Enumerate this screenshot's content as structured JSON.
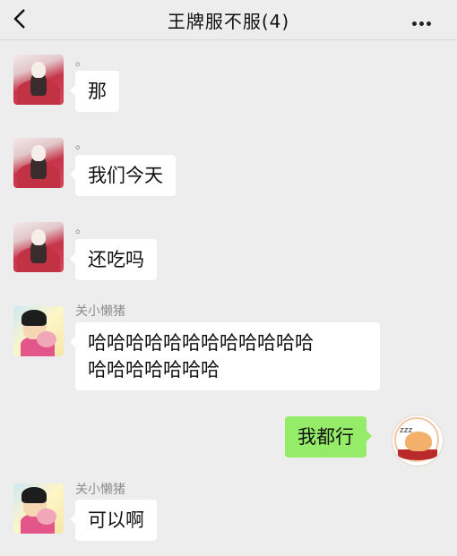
{
  "header": {
    "title": "王牌服不服(4)",
    "back_icon": "chevron-left-icon",
    "more_icon": "more-dots-icon"
  },
  "messages": [
    {
      "sender": "。",
      "text": "那",
      "avatar": "red-robe-avatar",
      "side": "left"
    },
    {
      "sender": "。",
      "text": "我们今天",
      "avatar": "red-robe-avatar",
      "side": "left"
    },
    {
      "sender": "。",
      "text": "还吃吗",
      "avatar": "red-robe-avatar",
      "side": "left"
    },
    {
      "sender": "关小懒猪",
      "text_lines": [
        "哈哈哈哈哈哈哈哈哈哈哈哈",
        "哈哈哈哈哈哈哈"
      ],
      "avatar": "cartoon-kid-avatar",
      "side": "left"
    },
    {
      "sender": "",
      "text": "我都行",
      "avatar": "sleeping-cat-avatar",
      "side": "right"
    },
    {
      "sender": "关小懒猪",
      "text": "可以啊",
      "avatar": "cartoon-kid-avatar",
      "side": "left"
    }
  ],
  "colors": {
    "background": "#ededed",
    "my_bubble": "#95ec69",
    "other_bubble": "#ffffff"
  }
}
